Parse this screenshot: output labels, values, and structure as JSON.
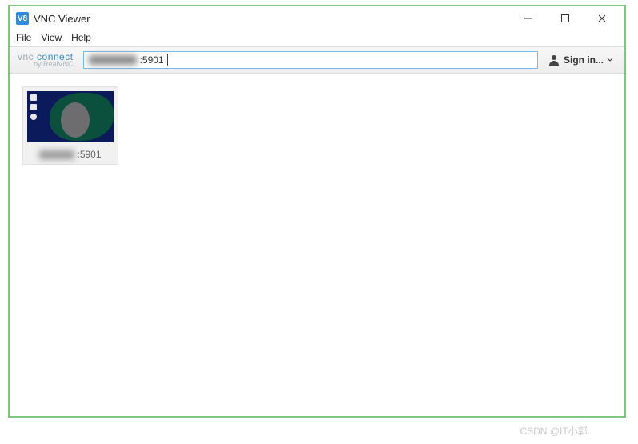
{
  "titlebar": {
    "app_icon": "V8",
    "title": "VNC Viewer"
  },
  "menubar": {
    "file": {
      "mnemonic": "F",
      "rest": "ile"
    },
    "view": {
      "mnemonic": "V",
      "rest": "iew"
    },
    "help": {
      "mnemonic": "H",
      "rest": "elp"
    }
  },
  "toolbar": {
    "brand_prefix": "vnc",
    "brand_word": "connect",
    "brand_sub": "by RealVNC",
    "address_suffix": ":5901",
    "signin_label": "Sign in..."
  },
  "connections": [
    {
      "label_suffix": ":5901"
    }
  ],
  "watermark": "CSDN @IT小郭."
}
